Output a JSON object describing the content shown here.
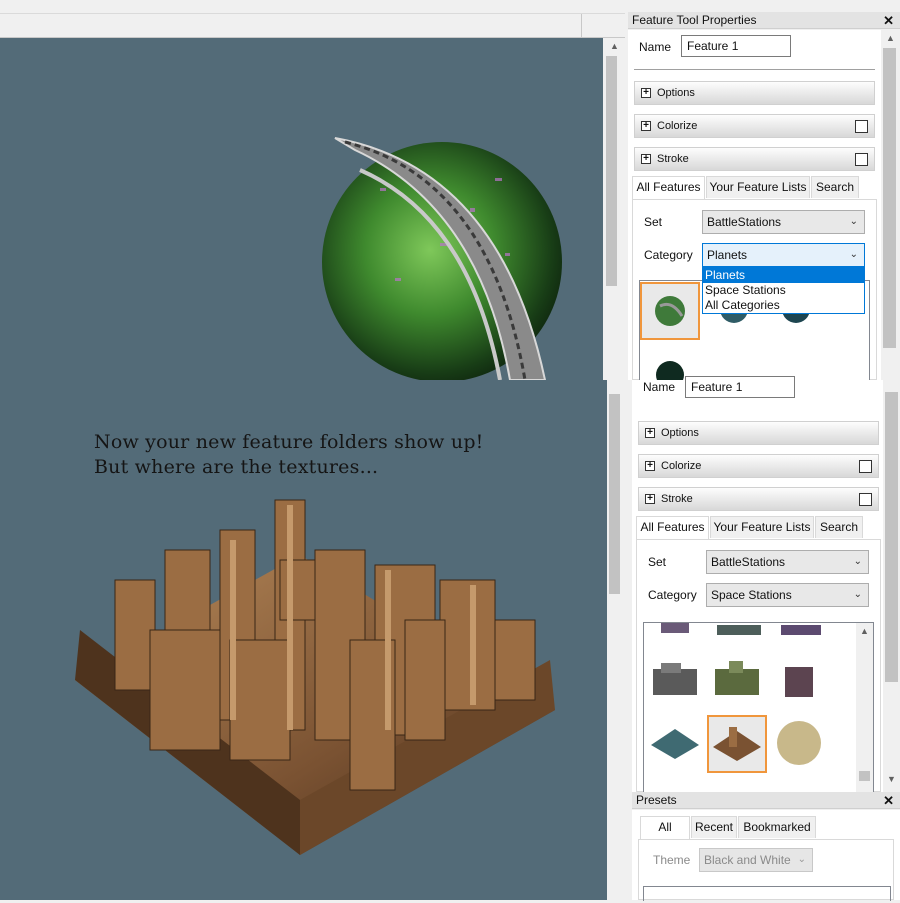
{
  "caption": {
    "line1": "Now your new feature folders show up!",
    "line2": "But where are the textures..."
  },
  "feature_panel_top": {
    "title": "Feature Tool Properties",
    "close": "✕",
    "name_label": "Name",
    "name_value": "Feature 1",
    "sections": [
      {
        "label": "Options",
        "checkbox": false
      },
      {
        "label": "Colorize",
        "checkbox": true
      },
      {
        "label": "Stroke",
        "checkbox": true
      }
    ],
    "tabs": [
      "All Features",
      "Your Feature Lists",
      "Search"
    ],
    "set_label": "Set",
    "set_value": "BattleStations",
    "category_label": "Category",
    "category_value": "Planets",
    "category_options": [
      "Planets",
      "Space Stations",
      "All Categories"
    ]
  },
  "feature_panel_bottom": {
    "name_label": "Name",
    "name_value": "Feature 1",
    "sections": [
      {
        "label": "Options",
        "checkbox": false
      },
      {
        "label": "Colorize",
        "checkbox": true
      },
      {
        "label": "Stroke",
        "checkbox": true
      }
    ],
    "tabs": [
      "All Features",
      "Your Feature Lists",
      "Search"
    ],
    "set_label": "Set",
    "set_value": "BattleStations",
    "category_label": "Category",
    "category_value": "Space Stations"
  },
  "presets_panel": {
    "title": "Presets",
    "close": "✕",
    "tabs": [
      "All",
      "Recent",
      "Bookmarked"
    ],
    "theme_label": "Theme",
    "theme_value": "Black and White"
  },
  "icons": {
    "close": "close-icon",
    "expand": "plus-box-icon",
    "dropdown": "chevron-down-icon",
    "scroll_up": "scroll-up-arrow-icon",
    "scroll_down": "scroll-down-arrow-icon"
  },
  "colors": {
    "canvas": "#536b78",
    "selection": "#0078d7",
    "selected_thumb_border": "#f0963c"
  }
}
